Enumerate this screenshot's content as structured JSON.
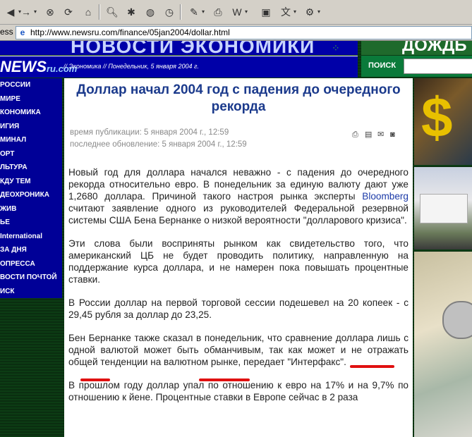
{
  "toolbar": {
    "icons": [
      "back-icon",
      "forward-icon",
      "stop-icon",
      "refresh-icon",
      "home-icon",
      "search-icon",
      "favorites-icon",
      "media-icon",
      "history-icon",
      "edit-icon",
      "print-icon",
      "word-icon",
      "messenger-icon",
      "translate-icon",
      "tools-icon"
    ]
  },
  "address": {
    "label": "ess",
    "url": "http://www.newsru.com/finance/05jan2004/dollar.html"
  },
  "header": {
    "top_title": "НОВОСТИ ЭКОНОМИКИ",
    "right_banner": "ДОЖДЬ",
    "logo_main": "NEWS",
    "logo_ru": "ru.com",
    "breadcrumb": "// Экономика // Понедельник, 5 января 2004 г.",
    "search_label": "ПОИСК"
  },
  "leftnav": {
    "items": [
      "РОССИИ",
      "МИРЕ",
      "КОНОМИКА",
      "ИГИЯ",
      "МИНАЛ",
      "ОРТ",
      "ЛЬТУРА",
      "КДУ ТЕМ",
      "ДЕОХРОНИКА",
      "ЖИВ",
      "ЬЕ",
      "International",
      "ЗА ДНЯ",
      "ОПРЕССА",
      "ВОСТИ ПОЧТОЙ",
      "ИСК"
    ]
  },
  "article": {
    "title": "Доллар начал 2004 год с падения до очередного рекорда",
    "published": "время публикации: 5 января 2004 г., 12:59",
    "updated": "последнее обновление: 5 января 2004 г., 12:59",
    "p1_a": "Новый год для доллара начался неважно - с падения до очередного рекорда относительно евро. В понедельник за единую валюту дают уже 1,2680 доллара. Причиной такого настроя рынка эксперты ",
    "p1_link": "Bloomberg",
    "p1_b": " считают заявление одного из руководителей Федеральной резервной системы США Бена Бернанке о низкой вероятности \"долларового кризиса\".",
    "p2": "Эти слова были восприняты рынком как свидетельство того, что американский ЦБ не будет проводить политику, направленную на поддержание курса доллара, и не намерен пока повышать процентные ставки.",
    "p3": "В России доллар на первой торговой сессии подешевел на 20 копеек - с 29,45 рубля за доллар до 23,25.",
    "p4": "Бен Бернанке также сказал в понедельник, что сравнение доллара лишь с одной валютой может быть обманчивым, так как может и не отражать общей тенденции на валютном рынке, передает \"Интерфакс\".",
    "p5": "В прошлом году доллар упал по отношению к евро на 17% и на 9,7% по отношению к йене. Процентные ставки в Европе сейчас в 2 раза"
  },
  "colors": {
    "nav_blue": "#000097",
    "title_blue": "#1b3a8c",
    "link_blue": "#1b3aa8",
    "underline_red": "#e01010",
    "search_green": "#0a7a3a"
  }
}
